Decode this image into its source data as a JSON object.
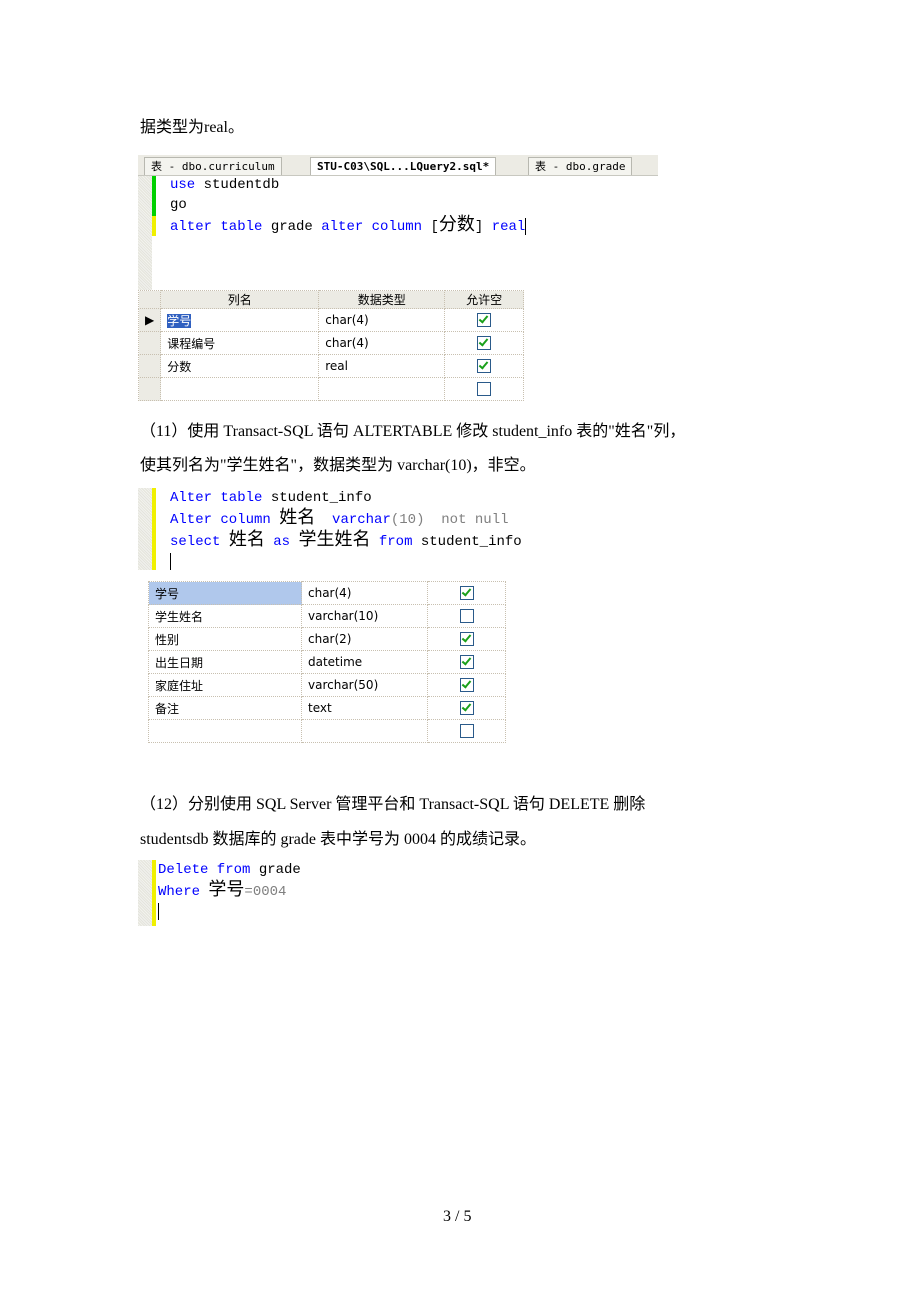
{
  "intro_line": "据类型为real。",
  "shot1": {
    "tabs": [
      "表 - dbo.curriculum",
      "STU-C03\\SQL...LQuery2.sql*",
      "表 - dbo.grade"
    ],
    "code": [
      [
        {
          "t": "use",
          "k": "kw"
        },
        {
          "t": " studentdb"
        }
      ],
      [
        {
          "t": "go"
        }
      ],
      [
        {
          "t": "alter table",
          "k": "kw"
        },
        {
          "t": " grade "
        },
        {
          "t": "alter column",
          "k": "kw"
        },
        {
          "t": " ["
        },
        {
          "t": "分数",
          "k": "cn"
        },
        {
          "t": "] "
        },
        {
          "t": "real",
          "k": "kw"
        }
      ]
    ],
    "table": {
      "headers": [
        "列名",
        "数据类型",
        "允许空"
      ],
      "rows": [
        [
          "学号",
          "char(4)",
          true
        ],
        [
          "课程编号",
          "char(4)",
          true
        ],
        [
          "分数",
          "real",
          true
        ],
        [
          "",
          "",
          false
        ]
      ]
    }
  },
  "para11": [
    "（11）使用 Transact-SQL 语句 ALTERTABLE 修改 student_info 表的\"姓名\"列，",
    "使其列名为\"学生姓名\"，数据类型为 varchar(10)，非空。"
  ],
  "shot2": {
    "code": [
      [
        {
          "t": "Alter table",
          "k": "kw"
        },
        {
          "t": " student_info"
        }
      ],
      [
        {
          "t": "Alter column",
          "k": "kw"
        },
        {
          "t": " "
        },
        {
          "t": "姓名",
          "k": "cn"
        },
        {
          "t": "  "
        },
        {
          "t": "varchar",
          "k": "kw"
        },
        {
          "t": "(10)  ",
          "k": "gr"
        },
        {
          "t": "not null",
          "k": "gr"
        }
      ],
      [
        {
          "t": "select",
          "k": "kw"
        },
        {
          "t": " "
        },
        {
          "t": "姓名",
          "k": "cn"
        },
        {
          "t": " "
        },
        {
          "t": "as",
          "k": "kw"
        },
        {
          "t": " "
        },
        {
          "t": "学生姓名",
          "k": "cn"
        },
        {
          "t": " "
        },
        {
          "t": "from",
          "k": "kw"
        },
        {
          "t": " student_info"
        }
      ]
    ],
    "table": {
      "rows": [
        [
          "学号",
          "char(4)",
          true
        ],
        [
          "学生姓名",
          "varchar(10)",
          false
        ],
        [
          "性别",
          "char(2)",
          true
        ],
        [
          "出生日期",
          "datetime",
          true
        ],
        [
          "家庭住址",
          "varchar(50)",
          true
        ],
        [
          "备注",
          "text",
          true
        ],
        [
          "",
          "",
          false
        ]
      ]
    }
  },
  "para12": [
    "（12）分别使用 SQL Server 管理平台和 Transact-SQL 语句 DELETE 删除",
    "studentsdb 数据库的 grade 表中学号为 0004 的成绩记录。"
  ],
  "shot3": {
    "code": [
      [
        {
          "t": "Delete from",
          "k": "kw"
        },
        {
          "t": " grade"
        }
      ],
      [
        {
          "t": "Where",
          "k": "kw"
        },
        {
          "t": " "
        },
        {
          "t": "学号",
          "k": "cn"
        },
        {
          "t": "=0004",
          "k": "gr"
        }
      ]
    ]
  },
  "footer": "3 / 5"
}
